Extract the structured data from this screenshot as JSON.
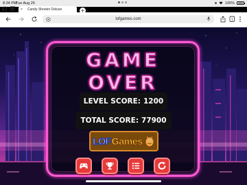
{
  "status_bar": {
    "time": "8:34 PM",
    "date": "Tue Aug 25",
    "battery": "100%",
    "battery_level": 1.0
  },
  "tab": {
    "title": "Candy Shooter Deluxe",
    "close_glyph": "×",
    "new_tab_glyph": "+"
  },
  "address_bar": {
    "url": "lofgames.com"
  },
  "icons": {
    "sidebar": "sidebar-icon",
    "tabs_overview": "tab-overview-icon",
    "back": "back-icon",
    "forward": "forward-icon",
    "reload": "reload-icon",
    "extensions": "extensions-icon",
    "microphone": "microphone-icon",
    "share": "share-icon",
    "tab_count": "tab-count-icon",
    "menu": "menu-dots-icon"
  },
  "game": {
    "title": "GAME OVER",
    "level_score_label": "LEVEL SCORE:",
    "level_score_value": "1200",
    "total_score_label": "TOTAL SCORE:",
    "total_score_value": "77900",
    "logo_part1": "LOF",
    "logo_part2": "Games",
    "buttons": [
      "gamepad-icon",
      "trophy-icon",
      "list-icon",
      "restart-icon"
    ]
  },
  "colors": {
    "panel_border": "#ff5ad2",
    "button_red": "#e63a3a",
    "logo_bg": "#7a4a0c"
  }
}
